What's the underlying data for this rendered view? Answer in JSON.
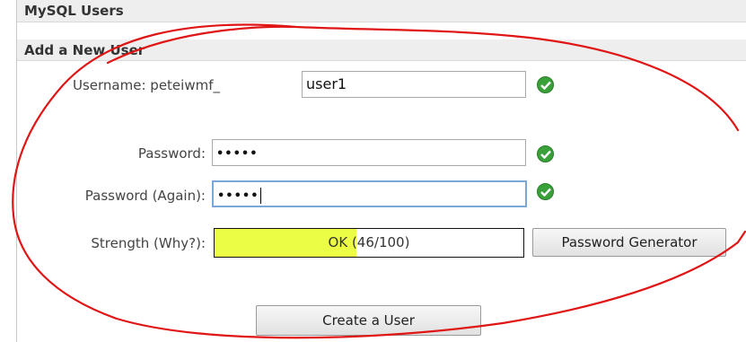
{
  "section": {
    "title": "MySQL Users"
  },
  "form": {
    "title": "Add a New User",
    "username": {
      "label": "Username:",
      "prefix": "peteiwmf_",
      "value": "user1"
    },
    "password": {
      "label": "Password:",
      "masked": "•••••"
    },
    "password_again": {
      "label": "Password (Again):",
      "masked": "•••••"
    },
    "strength": {
      "label": "Strength (Why?):",
      "text": "OK (46/100)",
      "score": 46,
      "max": 100,
      "fill_color": "#ecfd45"
    },
    "password_generator_label": "Password Generator",
    "create_button_label": "Create a User"
  },
  "colors": {
    "valid_check": "#3aa03a",
    "annotation": "#e01515",
    "focus_border": "#7aa7dc"
  }
}
